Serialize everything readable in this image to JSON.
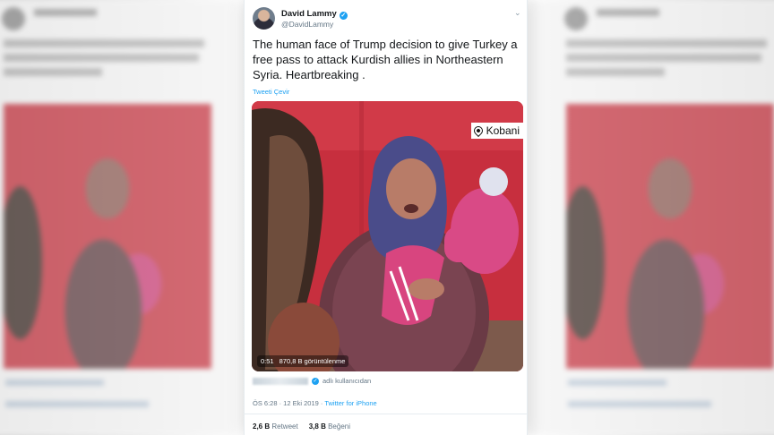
{
  "tweet": {
    "author_name": "David Lammy",
    "author_handle": "@DavidLammy",
    "text": "The human face of Trump decision to give Turkey a free pass to attack Kurdish allies in Northeastern Syria. Heartbreaking .",
    "translate_label": "Tweeti Çevir",
    "caret_icon": "chevron-down-icon"
  },
  "media": {
    "location_label": "Kobani",
    "duration": "0:51",
    "views": "870,8 B görüntülenme"
  },
  "attribution": {
    "suffix": "adlı kullanıcıdan"
  },
  "meta": {
    "timestamp": "ÖS 6:28 · 12 Eki 2019 ·",
    "source": "Twitter for iPhone"
  },
  "stats": {
    "retweets_count": "2,6 B",
    "retweets_label": "Retweet",
    "likes_count": "3,8 B",
    "likes_label": "Beğeni"
  },
  "colors": {
    "accent": "#1da1f2",
    "text": "#14171a",
    "secondary": "#657786",
    "media_background": "#c72f3e"
  }
}
